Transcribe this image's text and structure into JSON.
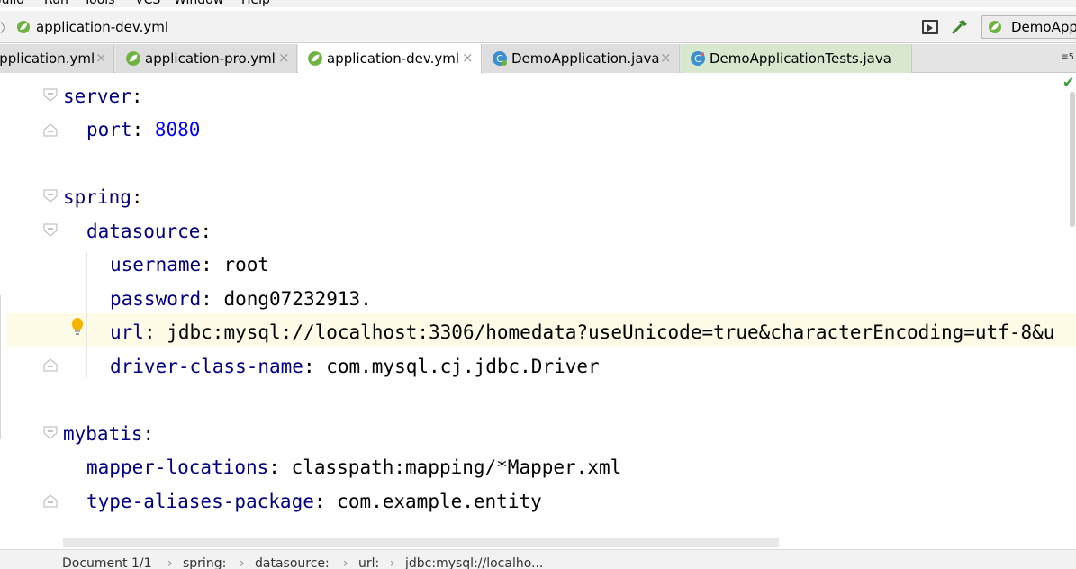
{
  "menubar": {
    "items": [
      "Build",
      "Run",
      "Tools",
      "VCS",
      "Window",
      "Help"
    ]
  },
  "navbar": {
    "file": "application-dev.yml",
    "run_config": "DemoApp"
  },
  "tabs": [
    {
      "label": "application.yml",
      "close": "×",
      "icon": "spring-leaf-icon"
    },
    {
      "label": "application-pro.yml",
      "close": "×",
      "icon": "spring-leaf-icon"
    },
    {
      "label": "application-dev.yml",
      "close": "×",
      "icon": "spring-leaf-icon",
      "active": true
    },
    {
      "label": "DemoApplication.java",
      "close": "×",
      "icon": "java-class-icon"
    },
    {
      "label": "DemoApplicationTests.java",
      "close": "",
      "icon": "java-class-icon"
    }
  ],
  "tab_overflow": "≡5",
  "editor": {
    "lines": [
      {
        "key": "server",
        "sep": ":",
        "value": ""
      },
      {
        "key": "port",
        "sep": ": ",
        "value": "8080"
      },
      {
        "key": "spring",
        "sep": ":",
        "value": ""
      },
      {
        "key": "datasource",
        "sep": ":",
        "value": ""
      },
      {
        "key": "username",
        "sep": ": ",
        "value": "root"
      },
      {
        "key": "password",
        "sep": ": ",
        "value": "dong07232913."
      },
      {
        "key": "url",
        "sep": ": ",
        "value": "jdbc:mysql://localhost:3306/homedata?useUnicode=true&characterEncoding=utf-8&u"
      },
      {
        "key": "driver-class-name",
        "sep": ": ",
        "value": "com.mysql.cj.jdbc.Driver"
      },
      {
        "key": "mybatis",
        "sep": ":",
        "value": ""
      },
      {
        "key": "mapper-locations",
        "sep": ": ",
        "value": "classpath:mapping/*Mapper.xml"
      },
      {
        "key": "type-aliases-package",
        "sep": ": ",
        "value": "com.example.entity"
      }
    ]
  },
  "breadcrumb": {
    "document": "Document 1/1",
    "parts": [
      "spring:",
      "datasource:",
      "url:",
      "jdbc:mysql://localho..."
    ]
  },
  "colors": {
    "key": "#000080",
    "number": "#0000ff",
    "current_line": "#fdfbe6",
    "spring_green": "#6db33f"
  }
}
